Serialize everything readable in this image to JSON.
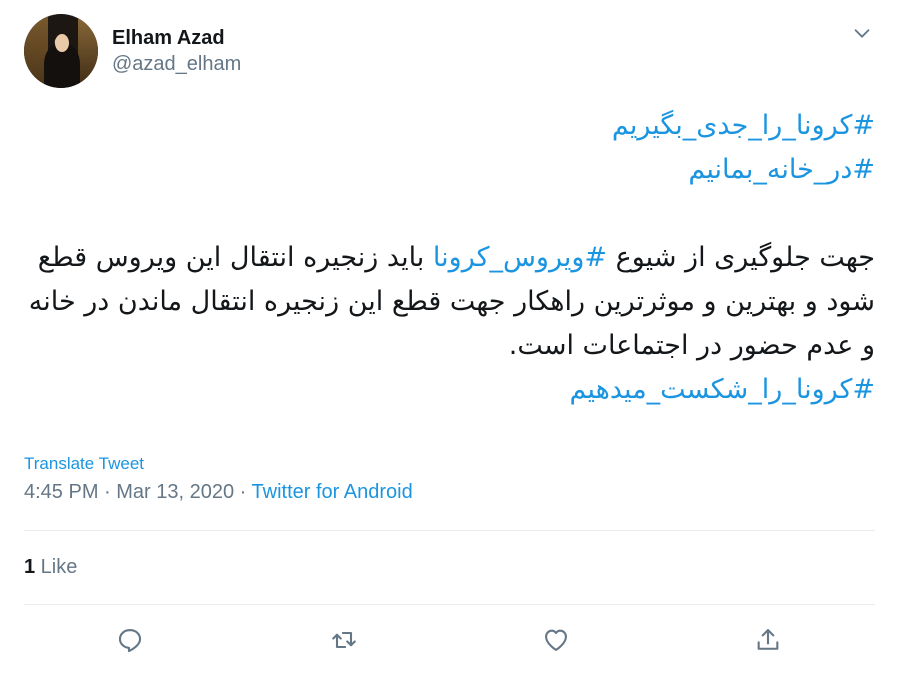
{
  "author": {
    "display_name": "Elham Azad",
    "handle": "@azad_elham"
  },
  "tweet": {
    "line1": "#کرونا_را_جدی_بگیریم",
    "line2": "#در_خانه_بمانیم",
    "body_before": "جهت جلوگیری از شیوع ",
    "body_hashtag": "#ویروس_کرونا",
    "body_after": " باید زنجیره انتقال این ویروس قطع شود و بهترین و موثرترین راهکار جهت قطع این زنجیره انتقال ماندن در خانه و عدم حضور در اجتماعات است.",
    "line_last": "#کرونا_را_شکست_میدهیم"
  },
  "translate_label": "Translate Tweet",
  "meta": {
    "time": "4:45 PM",
    "separator": " · ",
    "date": "Mar 13, 2020",
    "source": "Twitter for Android"
  },
  "likes": {
    "count": "1",
    "label": " Like"
  },
  "icons": {
    "menu": "chevron-down-icon",
    "reply": "reply-icon",
    "retweet": "retweet-icon",
    "like": "heart-icon",
    "share": "share-icon"
  },
  "colors": {
    "link": "#1b95e0",
    "text": "#14171a",
    "muted": "#657786",
    "divider": "#e6ecf0"
  }
}
